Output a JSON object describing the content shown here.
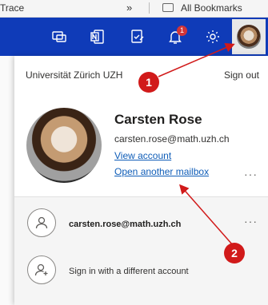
{
  "browser": {
    "bookmark_left": "Trace",
    "bookmark_overflow": "»",
    "all_bookmarks": "All Bookmarks"
  },
  "topbar": {
    "notification_count": "1",
    "icons": [
      "meet-now-icon",
      "onenote-icon",
      "to-do-icon",
      "bell-icon",
      "gear-icon"
    ]
  },
  "account_panel": {
    "organization": "Universität Zürich UZH",
    "sign_out": "Sign out",
    "name": "Carsten Rose",
    "email": "carsten.rose@math.uzh.ch",
    "view_account": "View account",
    "open_another_mailbox": "Open another mailbox",
    "more": "···"
  },
  "other_accounts": {
    "account_email": "carsten.rose@math.uzh.ch",
    "more": "···",
    "sign_in_different": "Sign in with a different account"
  },
  "annotations": {
    "marker_1": "1",
    "marker_2": "2",
    "color": "#d11a1a"
  },
  "colors": {
    "topbar": "#0f3bb8",
    "link": "#0f5db8"
  }
}
